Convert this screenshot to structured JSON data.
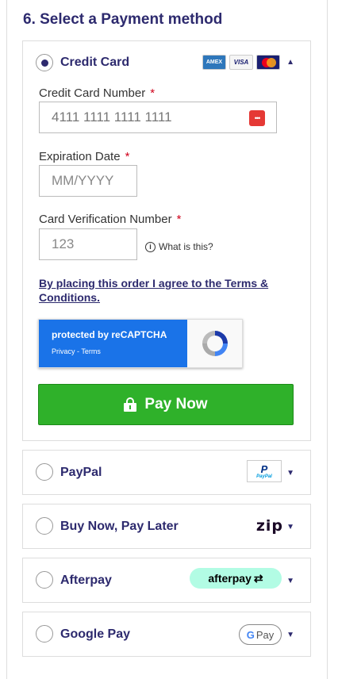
{
  "section_title": "6. Select a Payment method",
  "credit_card": {
    "label": "Credit Card",
    "card_number": {
      "label": "Credit Card Number",
      "required": "*",
      "value": "4111 1111 1111 1111"
    },
    "expiration": {
      "label": "Expiration Date",
      "required": "*",
      "placeholder": "MM/YYYY"
    },
    "cvv": {
      "label": "Card Verification Number",
      "required": "*",
      "placeholder": "123",
      "help": "What is this?"
    },
    "terms": "By placing this order I agree to the Terms & Conditions.",
    "recaptcha": {
      "title": "protected by reCAPTCHA",
      "links": "Privacy - Terms"
    },
    "pay_button": "Pay Now"
  },
  "methods": [
    {
      "label": "PayPal",
      "logo": "PayPal"
    },
    {
      "label": "Buy Now, Pay Later",
      "logo": "zip"
    },
    {
      "label": "Afterpay",
      "logo": "afterpay"
    },
    {
      "label": "Google Pay",
      "logo": "Pay"
    }
  ],
  "colors": {
    "accent": "#2d2a6e",
    "pay_button": "#2fb12a",
    "required": "#d0021b",
    "afterpay_bg": "#b2fce4"
  },
  "icons": {
    "caret_up": "triangle-up",
    "caret_down": "triangle-down",
    "lock": "lock-icon",
    "info": "info-icon"
  }
}
